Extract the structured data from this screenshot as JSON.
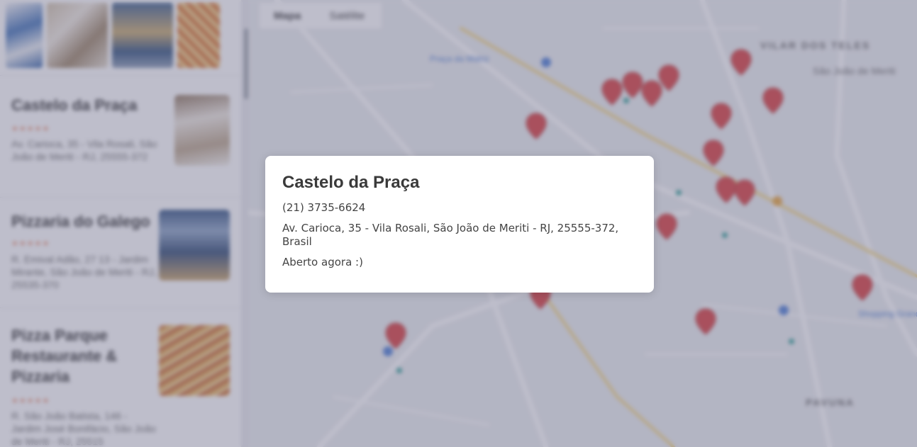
{
  "list": {
    "results": [
      {
        "name": "Castelo da Praça",
        "stars": "★★★★★",
        "address": "Av. Carioca, 35 - Vila Rosali, São João de Meriti - RJ, 25555-372"
      },
      {
        "name": "Pizzaria do Galego",
        "stars": "★★★★★",
        "address": "R. Emival Adão, 27 13 - Jardim Mirante, São João de Meriti - RJ, 25535-370"
      },
      {
        "name": "Pizza Parque Restaurante & Pizzaria",
        "stars": "★★★★★",
        "address": "R. São João Batista, 146 - Jardim José Bonifácio, São João de Meriti - RJ, 25515"
      }
    ]
  },
  "map": {
    "toggle": {
      "map_label": "Mapa",
      "satellite_label": "Satélite"
    },
    "area_labels": [
      "VILAR DOS TELES",
      "São João de Meriti",
      "PAVUNA",
      "Shopping Grande Rio",
      "Praça da Matriz"
    ]
  },
  "modal": {
    "title": "Castelo da Praça",
    "phone": "(21) 3735-6624",
    "address": "Av. Carioca, 35 - Vila Rosali, São João de Meriti - RJ, 25555-372, Brasil",
    "status": "Aberto agora :)"
  },
  "colors": {
    "overlay": "#6e6e8c",
    "marker": "#d93838",
    "modal_bg": "#ffffff",
    "text_dark": "#3a3a3a"
  }
}
